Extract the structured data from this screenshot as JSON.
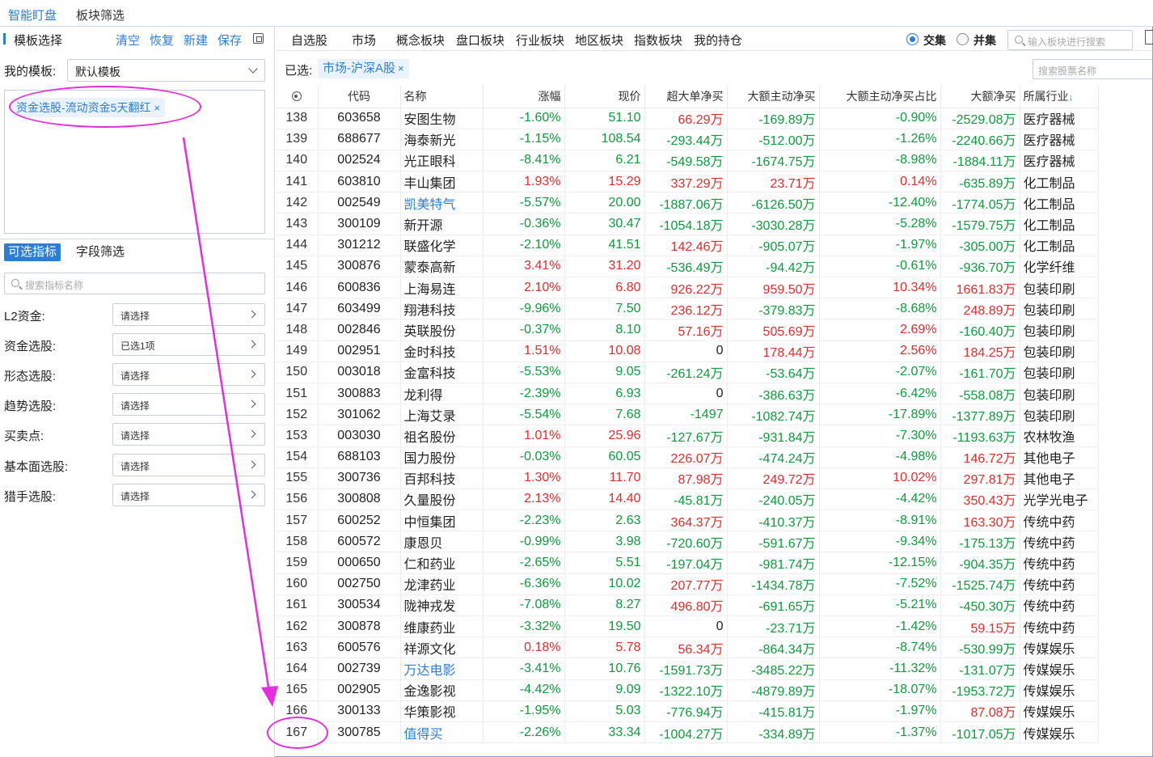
{
  "top_tabs": [
    "智能盯盘",
    "板块筛选"
  ],
  "left": {
    "title": "模板选择",
    "actions": [
      "清空",
      "恢复",
      "新建",
      "保存"
    ],
    "my_template_label": "我的模板:",
    "template_value": "默认模板",
    "selected_condition": "资金选股-流动资金5天翻红",
    "subtabs": [
      "可选指标",
      "字段筛选"
    ],
    "search_placeholder": "搜索指标名称",
    "filters": [
      {
        "label": "L2资金:",
        "value": "请选择"
      },
      {
        "label": "资金选股:",
        "value": "已选1项"
      },
      {
        "label": "形态选股:",
        "value": "请选择"
      },
      {
        "label": "趋势选股:",
        "value": "请选择"
      },
      {
        "label": "买卖点:",
        "value": "请选择"
      },
      {
        "label": "基本面选股:",
        "value": "请选择"
      },
      {
        "label": "猎手选股:",
        "value": "请选择"
      }
    ]
  },
  "nav": {
    "items": [
      "自选股",
      "市场",
      "概念板块",
      "盘口板块",
      "行业板块",
      "地区板块",
      "指数板块",
      "我的持仓"
    ],
    "radio_intersect": "交集",
    "radio_union": "并集",
    "block_search_placeholder": "输入板块进行搜索"
  },
  "selected": {
    "label": "已选:",
    "tag": "市场-沪深A股",
    "stock_search_placeholder": "搜索股票名称"
  },
  "table": {
    "headers": [
      "代码",
      "名称",
      "涨幅",
      "现价",
      "超大单净买",
      "大额主动净买",
      "大额主动净买占比",
      "大额净买",
      "所属行业"
    ],
    "rows": [
      {
        "idx": "138",
        "code": "603658",
        "name": "安图生物",
        "chg": "-1.60%",
        "price": "51.10",
        "super": "66.29万",
        "big": "-169.89万",
        "ratio": "-0.90%",
        "net": "-2529.08万",
        "ind": "医疗器械"
      },
      {
        "idx": "139",
        "code": "688677",
        "name": "海泰新光",
        "chg": "-1.15%",
        "price": "108.54",
        "super": "-293.44万",
        "big": "-512.00万",
        "ratio": "-1.26%",
        "net": "-2240.66万",
        "ind": "医疗器械"
      },
      {
        "idx": "140",
        "code": "002524",
        "name": "光正眼科",
        "chg": "-8.41%",
        "price": "6.21",
        "super": "-549.58万",
        "big": "-1674.75万",
        "ratio": "-8.98%",
        "net": "-1884.11万",
        "ind": "医疗器械"
      },
      {
        "idx": "141",
        "code": "603810",
        "name": "丰山集团",
        "chg": "1.93%",
        "price": "15.29",
        "super": "337.29万",
        "big": "23.71万",
        "ratio": "0.14%",
        "net": "-635.89万",
        "ind": "化工制品"
      },
      {
        "idx": "142",
        "code": "002549",
        "name": "凯美特气",
        "chg": "-5.57%",
        "price": "20.00",
        "super": "-1887.06万",
        "big": "-6126.50万",
        "ratio": "-12.40%",
        "net": "-1774.05万",
        "ind": "化工制品",
        "link": true
      },
      {
        "idx": "143",
        "code": "300109",
        "name": "新开源",
        "chg": "-0.36%",
        "price": "30.47",
        "super": "-1054.18万",
        "big": "-3030.28万",
        "ratio": "-5.28%",
        "net": "-1579.75万",
        "ind": "化工制品"
      },
      {
        "idx": "144",
        "code": "301212",
        "name": "联盛化学",
        "chg": "-2.10%",
        "price": "41.51",
        "super": "142.46万",
        "big": "-905.07万",
        "ratio": "-1.97%",
        "net": "-305.00万",
        "ind": "化工制品"
      },
      {
        "idx": "145",
        "code": "300876",
        "name": "蒙泰高新",
        "chg": "3.41%",
        "price": "31.20",
        "super": "-536.49万",
        "big": "-94.42万",
        "ratio": "-0.61%",
        "net": "-936.70万",
        "ind": "化学纤维"
      },
      {
        "idx": "146",
        "code": "600836",
        "name": "上海易连",
        "chg": "2.10%",
        "price": "6.80",
        "super": "926.22万",
        "big": "959.50万",
        "ratio": "10.34%",
        "net": "1661.83万",
        "ind": "包装印刷"
      },
      {
        "idx": "147",
        "code": "603499",
        "name": "翔港科技",
        "chg": "-9.96%",
        "price": "7.50",
        "super": "236.12万",
        "big": "-379.83万",
        "ratio": "-8.68%",
        "net": "248.89万",
        "ind": "包装印刷"
      },
      {
        "idx": "148",
        "code": "002846",
        "name": "英联股份",
        "chg": "-0.37%",
        "price": "8.10",
        "super": "57.16万",
        "big": "505.69万",
        "ratio": "2.69%",
        "net": "-160.40万",
        "ind": "包装印刷"
      },
      {
        "idx": "149",
        "code": "002951",
        "name": "金时科技",
        "chg": "1.51%",
        "price": "10.08",
        "super": "0",
        "big": "178.44万",
        "ratio": "2.56%",
        "net": "184.25万",
        "ind": "包装印刷"
      },
      {
        "idx": "150",
        "code": "003018",
        "name": "金富科技",
        "chg": "-5.53%",
        "price": "9.05",
        "super": "-261.24万",
        "big": "-53.64万",
        "ratio": "-2.07%",
        "net": "-161.70万",
        "ind": "包装印刷"
      },
      {
        "idx": "151",
        "code": "300883",
        "name": "龙利得",
        "chg": "-2.39%",
        "price": "6.93",
        "super": "0",
        "big": "-386.63万",
        "ratio": "-6.42%",
        "net": "-558.08万",
        "ind": "包装印刷"
      },
      {
        "idx": "152",
        "code": "301062",
        "name": "上海艾录",
        "chg": "-5.54%",
        "price": "7.68",
        "super": "-1497",
        "big": "-1082.74万",
        "ratio": "-17.89%",
        "net": "-1377.89万",
        "ind": "包装印刷"
      },
      {
        "idx": "153",
        "code": "003030",
        "name": "祖名股份",
        "chg": "1.01%",
        "price": "25.96",
        "super": "-127.67万",
        "big": "-931.84万",
        "ratio": "-7.30%",
        "net": "-1193.63万",
        "ind": "农林牧渔"
      },
      {
        "idx": "154",
        "code": "688103",
        "name": "国力股份",
        "chg": "-0.03%",
        "price": "60.05",
        "super": "226.07万",
        "big": "-474.24万",
        "ratio": "-4.98%",
        "net": "146.72万",
        "ind": "其他电子"
      },
      {
        "idx": "155",
        "code": "300736",
        "name": "百邦科技",
        "chg": "1.30%",
        "price": "11.70",
        "super": "87.98万",
        "big": "249.72万",
        "ratio": "10.02%",
        "net": "297.81万",
        "ind": "其他电子"
      },
      {
        "idx": "156",
        "code": "300808",
        "name": "久量股份",
        "chg": "2.13%",
        "price": "14.40",
        "super": "-45.81万",
        "big": "-240.05万",
        "ratio": "-4.42%",
        "net": "350.43万",
        "ind": "光学光电子"
      },
      {
        "idx": "157",
        "code": "600252",
        "name": "中恒集团",
        "chg": "-2.23%",
        "price": "2.63",
        "super": "364.37万",
        "big": "-410.37万",
        "ratio": "-8.91%",
        "net": "163.30万",
        "ind": "传统中药"
      },
      {
        "idx": "158",
        "code": "600572",
        "name": "康恩贝",
        "chg": "-0.99%",
        "price": "3.98",
        "super": "-720.60万",
        "big": "-591.67万",
        "ratio": "-9.34%",
        "net": "-175.13万",
        "ind": "传统中药"
      },
      {
        "idx": "159",
        "code": "000650",
        "name": "仁和药业",
        "chg": "-2.65%",
        "price": "5.51",
        "super": "-197.04万",
        "big": "-981.74万",
        "ratio": "-12.15%",
        "net": "-904.35万",
        "ind": "传统中药"
      },
      {
        "idx": "160",
        "code": "002750",
        "name": "龙津药业",
        "chg": "-6.36%",
        "price": "10.02",
        "super": "207.77万",
        "big": "-1434.78万",
        "ratio": "-7.52%",
        "net": "-1525.74万",
        "ind": "传统中药"
      },
      {
        "idx": "161",
        "code": "300534",
        "name": "陇神戎发",
        "chg": "-7.08%",
        "price": "8.27",
        "super": "496.80万",
        "big": "-691.65万",
        "ratio": "-5.21%",
        "net": "-450.30万",
        "ind": "传统中药"
      },
      {
        "idx": "162",
        "code": "300878",
        "name": "维康药业",
        "chg": "-3.32%",
        "price": "19.50",
        "super": "0",
        "big": "-23.71万",
        "ratio": "-1.42%",
        "net": "59.15万",
        "ind": "传统中药"
      },
      {
        "idx": "163",
        "code": "600576",
        "name": "祥源文化",
        "chg": "0.18%",
        "price": "5.78",
        "super": "56.34万",
        "big": "-864.34万",
        "ratio": "-8.74%",
        "net": "-530.99万",
        "ind": "传媒娱乐"
      },
      {
        "idx": "164",
        "code": "002739",
        "name": "万达电影",
        "chg": "-3.41%",
        "price": "10.76",
        "super": "-1591.73万",
        "big": "-3485.22万",
        "ratio": "-11.32%",
        "net": "-131.07万",
        "ind": "传媒娱乐",
        "link": true
      },
      {
        "idx": "165",
        "code": "002905",
        "name": "金逸影视",
        "chg": "-4.42%",
        "price": "9.09",
        "super": "-1322.10万",
        "big": "-4879.89万",
        "ratio": "-18.07%",
        "net": "-1953.72万",
        "ind": "传媒娱乐"
      },
      {
        "idx": "166",
        "code": "300133",
        "name": "华策影视",
        "chg": "-1.95%",
        "price": "5.03",
        "super": "-776.94万",
        "big": "-415.81万",
        "ratio": "-1.97%",
        "net": "87.08万",
        "ind": "传媒娱乐"
      },
      {
        "idx": "167",
        "code": "300785",
        "name": "值得买",
        "chg": "-2.26%",
        "price": "33.34",
        "super": "-1004.27万",
        "big": "-334.89万",
        "ratio": "-1.37%",
        "net": "-1017.05万",
        "ind": "传媒娱乐",
        "link": true
      }
    ]
  },
  "colors": {
    "up": "#e82a2a",
    "down": "#0c9c3b",
    "accent": "#2a7ed8",
    "annotation": "#e52ee0"
  }
}
